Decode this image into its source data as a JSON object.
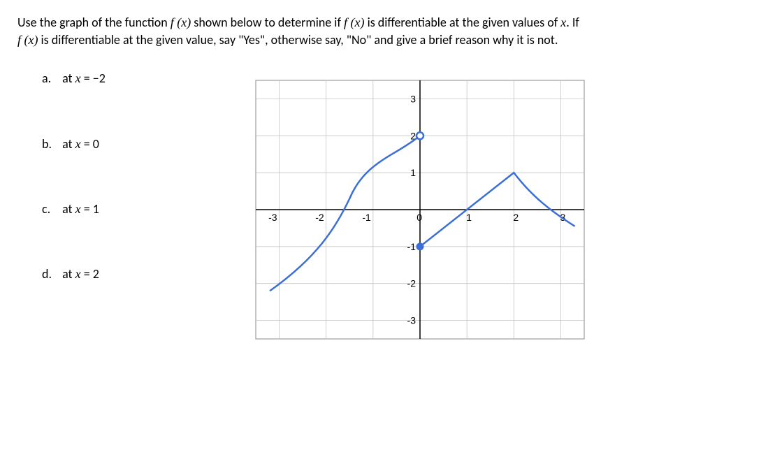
{
  "problem": {
    "line1_pre": "Use the graph of the function ",
    "line1_func": "f (x)",
    "line1_mid": " shown below to determine if ",
    "line1_func2": "f (x)",
    "line1_post": " is differentiable at the given values of ",
    "line1_var": "x",
    "line1_end": ". If",
    "line2_func": "f (x)",
    "line2_text": " is differentiable at the given value, say \"Yes\", otherwise say, \"No\" and give a brief reason why it is not."
  },
  "questions": {
    "a": {
      "label": "a.",
      "text_pre": "at ",
      "var": "x",
      "eq": " = ",
      "val": "−2"
    },
    "b": {
      "label": "b.",
      "text_pre": "at ",
      "var": "x",
      "eq": " = ",
      "val": "0"
    },
    "c": {
      "label": "c.",
      "text_pre": "at ",
      "var": "x",
      "eq": " = ",
      "val": "1"
    },
    "d": {
      "label": "d.",
      "text_pre": "at ",
      "var": "x",
      "eq": " = ",
      "val": "2"
    }
  },
  "chart_data": {
    "type": "line",
    "xlim": [
      -3.5,
      3.5
    ],
    "ylim": [
      -3.5,
      3.5
    ],
    "xticks": [
      -3,
      -2,
      -1,
      0,
      1,
      2,
      3
    ],
    "yticks": [
      -3,
      -2,
      -1,
      1,
      2,
      3
    ],
    "open_points": [
      {
        "x": 0,
        "y": 2
      }
    ],
    "closed_points": [
      {
        "x": 0,
        "y": -1
      }
    ],
    "left_piece": {
      "description": "Curve from lower-left rising steeply toward open circle at (0,2)",
      "points": [
        {
          "x": -3.2,
          "y": -2.2
        },
        {
          "x": -2.5,
          "y": -1.5
        },
        {
          "x": -2.0,
          "y": -0.9
        },
        {
          "x": -1.6,
          "y": 0.0
        },
        {
          "x": -1.3,
          "y": 0.7
        },
        {
          "x": -1.0,
          "y": 1.1
        },
        {
          "x": -0.7,
          "y": 1.4
        },
        {
          "x": -0.4,
          "y": 1.65
        },
        {
          "x": -0.1,
          "y": 1.95
        },
        {
          "x": 0.0,
          "y": 2.0
        }
      ]
    },
    "right_piece": {
      "description": "Piece starting at closed point (0,-1), rising to corner at (2,1), then falling",
      "points": [
        {
          "x": 0.0,
          "y": -1.0
        },
        {
          "x": 0.5,
          "y": -0.5
        },
        {
          "x": 1.0,
          "y": 0.0
        },
        {
          "x": 1.5,
          "y": 0.5
        },
        {
          "x": 2.0,
          "y": 1.0
        },
        {
          "x": 2.5,
          "y": 0.3
        },
        {
          "x": 3.0,
          "y": -0.2
        },
        {
          "x": 3.3,
          "y": -0.5
        }
      ]
    },
    "corner_at": {
      "x": 2,
      "y": 1
    }
  }
}
